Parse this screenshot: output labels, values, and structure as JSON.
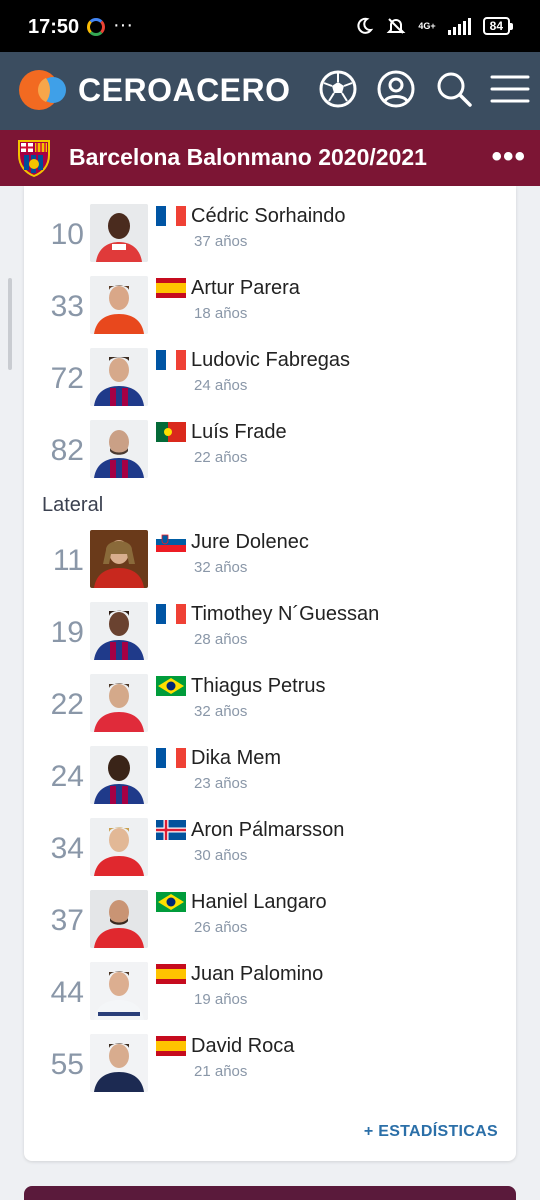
{
  "status_bar": {
    "time": "17:50",
    "more": "···",
    "network": "4G+",
    "battery": "84"
  },
  "header": {
    "brand": "CEROACERO"
  },
  "team_bar": {
    "title": "Barcelona Balonmano 2020/2021",
    "more": "•••"
  },
  "colors": {
    "topbar": "#3b4d60",
    "teambar": "#7c1534",
    "accent_link": "#2b6fa8",
    "number_gray": "#8a97a8"
  },
  "section_label": "Lateral",
  "players": [
    {
      "number": "10",
      "name": "Cédric Sorhaindo",
      "age": "37 años",
      "flag": "france"
    },
    {
      "number": "33",
      "name": "Artur Parera",
      "age": "18 años",
      "flag": "spain"
    },
    {
      "number": "72",
      "name": "Ludovic Fabregas",
      "age": "24 años",
      "flag": "france"
    },
    {
      "number": "82",
      "name": "Luís Frade",
      "age": "22 años",
      "flag": "portugal"
    },
    {
      "number": "11",
      "name": "Jure Dolenec",
      "age": "32 años",
      "flag": "slovenia"
    },
    {
      "number": "19",
      "name": "Timothey N´Guessan",
      "age": "28 años",
      "flag": "france"
    },
    {
      "number": "22",
      "name": "Thiagus Petrus",
      "age": "32 años",
      "flag": "brazil"
    },
    {
      "number": "24",
      "name": "Dika Mem",
      "age": "23 años",
      "flag": "france"
    },
    {
      "number": "34",
      "name": "Aron Pálmarsson",
      "age": "30 años",
      "flag": "iceland"
    },
    {
      "number": "37",
      "name": "Haniel Langaro",
      "age": "26 años",
      "flag": "brazil"
    },
    {
      "number": "44",
      "name": "Juan Palomino",
      "age": "19 años",
      "flag": "spain"
    },
    {
      "number": "55",
      "name": "David Roca",
      "age": "21 años",
      "flag": "spain"
    }
  ],
  "stats_link": "+ ESTADÍSTICAS"
}
